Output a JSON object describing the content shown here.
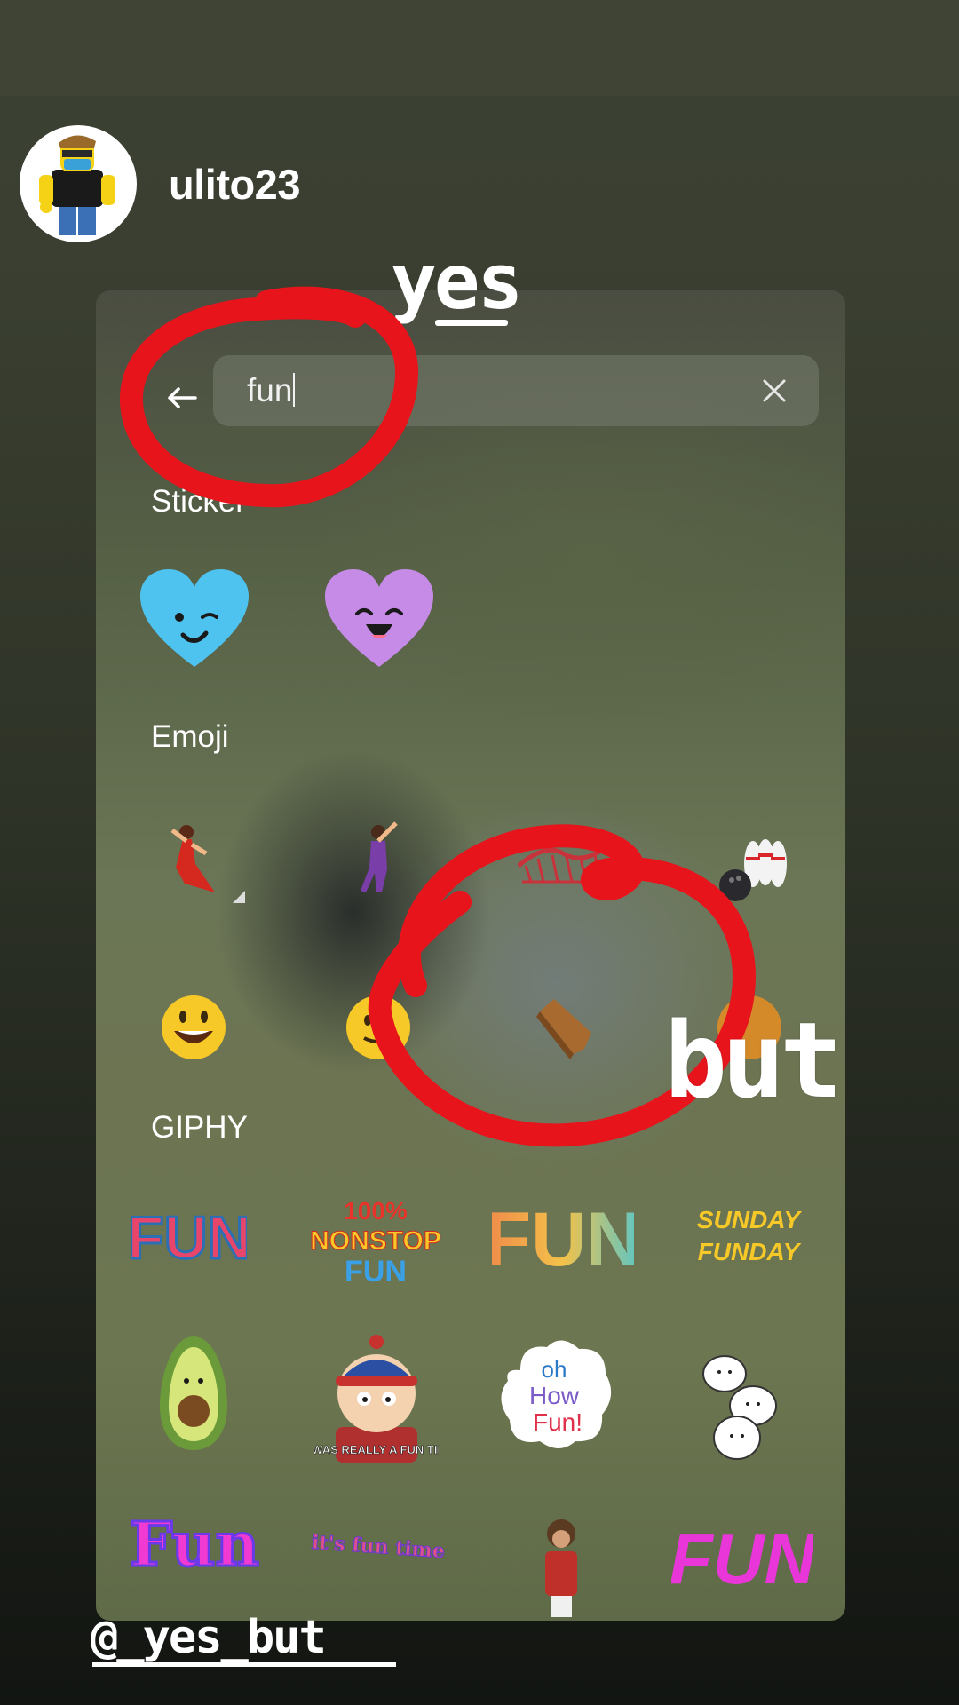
{
  "story": {
    "username": "ulito23",
    "top_caption": "yes",
    "side_caption": "but",
    "bottom_tag": "@_yes_but"
  },
  "search": {
    "query": "fun"
  },
  "sections": {
    "stickers": "Sticker",
    "emoji": "Emoji",
    "giphy": "GIPHY"
  },
  "giphy_items": {
    "item1": "FUN",
    "item2_line1": "100%",
    "item2_line2": "NONSTOP",
    "item2_line3": "FUN",
    "item3": "FUN",
    "item4_line1": "SUNDAY",
    "item4_line2": "FUNDAY",
    "item6": "IT WAS REALLY A FUN TIME",
    "item7_line1": "oh",
    "item7_line2": "How",
    "item7_line3": "Fun!",
    "item9": "Fun",
    "item10": "it's fun time",
    "item12": "FUN"
  },
  "icons": {
    "back": "arrow-left-icon",
    "clear": "close-icon"
  },
  "colors": {
    "scribble": "#e8141c",
    "heart_blue": "#4fc3f0",
    "heart_purple": "#c58be6"
  }
}
